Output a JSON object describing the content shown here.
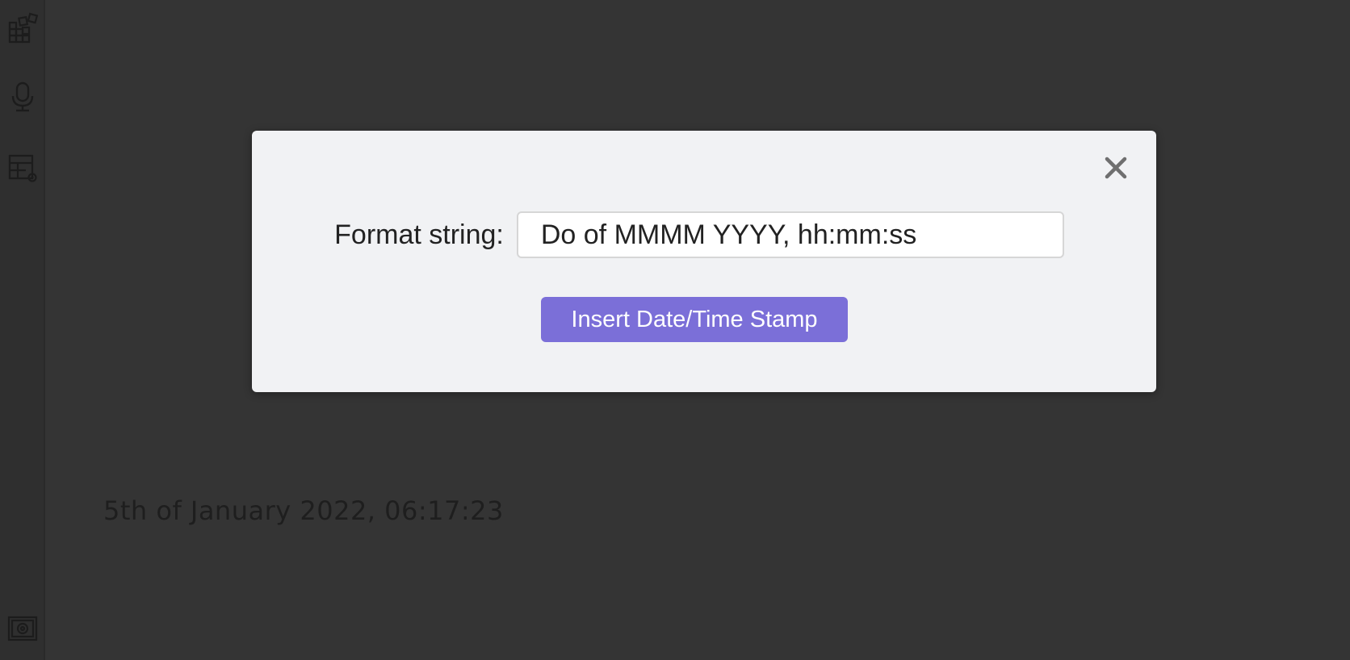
{
  "ribbon": {
    "items": [
      {
        "icon": "blocks-grid-icon"
      },
      {
        "icon": "microphone-icon"
      },
      {
        "icon": "table-settings-icon"
      }
    ],
    "bottom": {
      "icon": "vault-icon"
    }
  },
  "editor": {
    "content": "5th of January 2022, 06:17:23"
  },
  "modal": {
    "close_icon": "close-icon",
    "format_label": "Format string:",
    "format_value": "Do of MMMM YYYY, hh:mm:ss",
    "insert_button": "Insert Date/Time Stamp"
  },
  "colors": {
    "background": "#343434",
    "modal_bg": "#f1f2f4",
    "accent": "#7b6fd8",
    "editor_text": "#1e1e1e"
  }
}
